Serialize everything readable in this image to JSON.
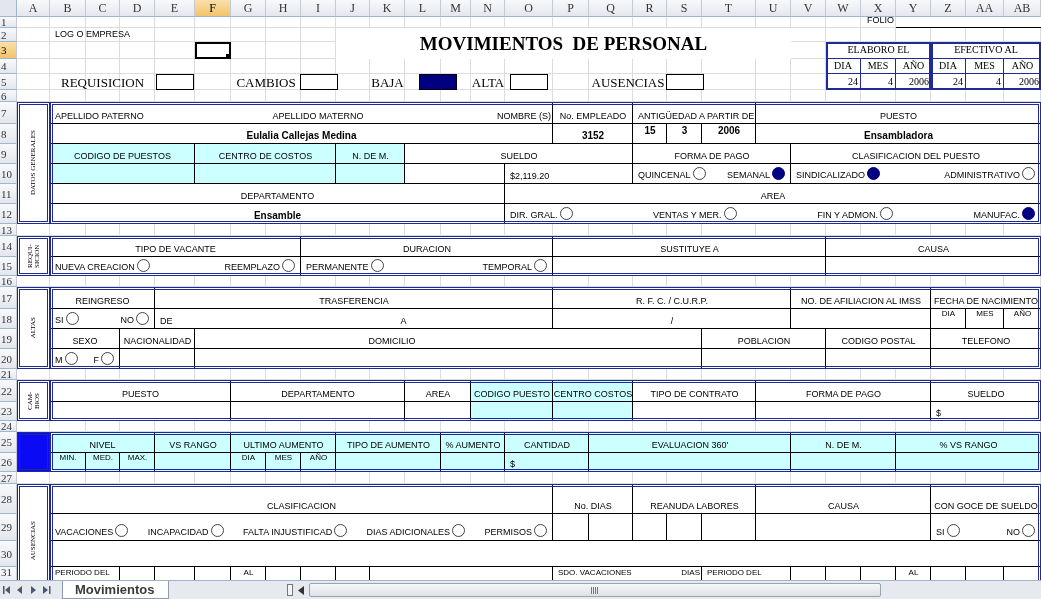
{
  "column_headers": [
    {
      "label": "A",
      "selected": false
    },
    {
      "label": "B",
      "selected": false
    },
    {
      "label": "C",
      "selected": false
    },
    {
      "label": "D",
      "selected": false
    },
    {
      "label": "E",
      "selected": false
    },
    {
      "label": "F",
      "selected": true
    },
    {
      "label": "G",
      "selected": false
    },
    {
      "label": "H",
      "selected": false
    },
    {
      "label": "I",
      "selected": false
    },
    {
      "label": "J",
      "selected": false
    },
    {
      "label": "K",
      "selected": false
    },
    {
      "label": "L",
      "selected": false
    },
    {
      "label": "M",
      "selected": false
    },
    {
      "label": "N",
      "selected": false
    },
    {
      "label": "O",
      "selected": false
    },
    {
      "label": "P",
      "selected": false
    },
    {
      "label": "Q",
      "selected": false
    },
    {
      "label": "R",
      "selected": false
    },
    {
      "label": "S",
      "selected": false
    },
    {
      "label": "T",
      "selected": false
    },
    {
      "label": "U",
      "selected": false
    },
    {
      "label": "V",
      "selected": false
    },
    {
      "label": "W",
      "selected": false
    },
    {
      "label": "X",
      "selected": false
    },
    {
      "label": "Y",
      "selected": false
    },
    {
      "label": "Z",
      "selected": false
    },
    {
      "label": "AA",
      "selected": false
    },
    {
      "label": "AB",
      "selected": false
    }
  ],
  "row_headers": [
    {
      "label": "1",
      "selected": false
    },
    {
      "label": "2",
      "selected": false
    },
    {
      "label": "3",
      "selected": true
    },
    {
      "label": "4",
      "selected": false
    },
    {
      "label": "5",
      "selected": false
    },
    {
      "label": "6",
      "selected": false
    },
    {
      "label": "7",
      "selected": false
    },
    {
      "label": "8",
      "selected": false
    },
    {
      "label": "9",
      "selected": false
    },
    {
      "label": "10",
      "selected": false
    },
    {
      "label": "11",
      "selected": false
    },
    {
      "label": "12",
      "selected": false
    },
    {
      "label": "13",
      "selected": false
    },
    {
      "label": "14",
      "selected": false
    },
    {
      "label": "15",
      "selected": false
    },
    {
      "label": "16",
      "selected": false
    },
    {
      "label": "17",
      "selected": false
    },
    {
      "label": "18",
      "selected": false
    },
    {
      "label": "19",
      "selected": false
    },
    {
      "label": "20",
      "selected": false
    },
    {
      "label": "21",
      "selected": false
    },
    {
      "label": "22",
      "selected": false
    },
    {
      "label": "23",
      "selected": false
    },
    {
      "label": "24",
      "selected": false
    },
    {
      "label": "25",
      "selected": false
    },
    {
      "label": "26",
      "selected": false
    },
    {
      "label": "27",
      "selected": false
    },
    {
      "label": "28",
      "selected": false
    },
    {
      "label": "29",
      "selected": false
    },
    {
      "label": "30",
      "selected": false
    },
    {
      "label": "31",
      "selected": false
    }
  ],
  "logo_text": "LOG O EMPRESA",
  "title": "MOVIMIENTOS  DE PERSONAL",
  "folio_label": "FOLIO",
  "movement_types": [
    {
      "label": "REQUISICION",
      "checked": false
    },
    {
      "label": "CAMBIOS",
      "checked": false
    },
    {
      "label": "BAJA",
      "checked": true
    },
    {
      "label": "ALTA",
      "checked": false
    },
    {
      "label": "AUSENCIAS",
      "checked": false
    }
  ],
  "date_blocks": [
    {
      "title": "ELABORO EL",
      "columns": [
        "DIA",
        "MES",
        "AÑO"
      ],
      "values": [
        "24",
        "4",
        "2006"
      ]
    },
    {
      "title": "EFECTIVO AL",
      "columns": [
        "DIA",
        "MES",
        "AÑO"
      ],
      "values": [
        "24",
        "4",
        "2006"
      ]
    }
  ],
  "sections": [
    {
      "kind": "labeled",
      "label": "DATOS GENERALES",
      "cells": [
        {
          "kind": "label",
          "text": "APELLIDO PATERNO"
        },
        {
          "kind": "label",
          "text": "APELLIDO MATERNO"
        },
        {
          "kind": "label",
          "text": "NOMBRE (S)"
        },
        {
          "kind": "label",
          "text": "No. EMPLEADO"
        },
        {
          "kind": "label",
          "text": "ANTIGÜEDAD A PARTIR DE"
        },
        {
          "kind": "label",
          "text": "PUESTO"
        },
        {
          "kind": "value",
          "text": "Eulalia Callejas Medina"
        },
        {
          "kind": "value",
          "text": "3152"
        },
        {
          "kind": "value",
          "text": "15"
        },
        {
          "kind": "value",
          "text": "3"
        },
        {
          "kind": "value",
          "text": "2006"
        },
        {
          "kind": "value",
          "text": "Ensambladora"
        },
        {
          "kind": "label",
          "text": "CODIGO DE PUESTOS"
        },
        {
          "kind": "label",
          "text": "CENTRO DE COSTOS"
        },
        {
          "kind": "label",
          "text": "N. DE M."
        },
        {
          "kind": "label",
          "text": "SUELDO"
        },
        {
          "kind": "label",
          "text": "FORMA DE PAGO"
        },
        {
          "kind": "label",
          "text": "CLASIFICACION DEL PUESTO"
        },
        {
          "kind": "label",
          "text": "$2,119.20"
        },
        {
          "kind": "options",
          "options": [
            {
              "label": "QUINCENAL",
              "checked": false
            },
            {
              "label": "SEMANAL",
              "checked": true
            }
          ]
        },
        {
          "kind": "options",
          "options": [
            {
              "label": "SINDICALIZADO",
              "checked": true
            },
            {
              "label": "ADMINISTRATIVO",
              "checked": false
            }
          ]
        },
        {
          "kind": "label",
          "text": "DEPARTAMENTO"
        },
        {
          "kind": "label",
          "text": "AREA"
        },
        {
          "kind": "value",
          "text": "Ensamble"
        },
        {
          "kind": "options",
          "options": [
            {
              "label": "DIR. GRAL.",
              "checked": false
            },
            {
              "label": "VENTAS Y MER.",
              "checked": false
            },
            {
              "label": "FIN Y ADMON.",
              "checked": false
            },
            {
              "label": "MANUFAC.",
              "checked": true
            }
          ]
        }
      ]
    },
    {
      "kind": "labeled",
      "label": "REQUI-SICION",
      "cells": [
        {
          "kind": "label",
          "text": "TIPO DE VACANTE"
        },
        {
          "kind": "label",
          "text": "DURACION"
        },
        {
          "kind": "label",
          "text": "SUSTITUYE A"
        },
        {
          "kind": "label",
          "text": "CAUSA"
        },
        {
          "kind": "options",
          "options": [
            {
              "label": "NUEVA CREACION",
              "checked": false
            },
            {
              "label": "REEMPLAZO",
              "checked": false
            }
          ]
        },
        {
          "kind": "options",
          "options": [
            {
              "label": "PERMANENTE",
              "checked": false
            },
            {
              "label": "TEMPORAL",
              "checked": false
            }
          ]
        }
      ]
    },
    {
      "kind": "labeled",
      "label": "ALTAS",
      "cells": [
        {
          "kind": "label",
          "text": "REINGRESO"
        },
        {
          "kind": "label",
          "text": "TRASFERENCIA"
        },
        {
          "kind": "label",
          "text": "R. F. C. / C.U.R.P."
        },
        {
          "kind": "label",
          "text": "NO. DE AFILIACION AL IMSS"
        },
        {
          "kind": "label",
          "text": "FECHA DE NACIMIENTO"
        },
        {
          "kind": "options",
          "options": [
            {
              "label": "SI",
              "checked": false
            },
            {
              "label": "NO",
              "checked": false
            }
          ]
        },
        {
          "kind": "label",
          "text": "DE"
        },
        {
          "kind": "label",
          "text": "A"
        },
        {
          "kind": "label",
          "text": "/"
        },
        {
          "kind": "sublabel",
          "text": "DIA"
        },
        {
          "kind": "sublabel",
          "text": "MES"
        },
        {
          "kind": "sublabel",
          "text": "AÑO"
        },
        {
          "kind": "label",
          "text": "SEXO"
        },
        {
          "kind": "label",
          "text": "NACIONALIDAD"
        },
        {
          "kind": "label",
          "text": "DOMICILIO"
        },
        {
          "kind": "label",
          "text": "POBLACION"
        },
        {
          "kind": "label",
          "text": "CODIGO POSTAL"
        },
        {
          "kind": "label",
          "text": "TELEFONO"
        },
        {
          "kind": "options",
          "options": [
            {
              "label": "M",
              "checked": false
            },
            {
              "label": "F",
              "checked": false
            }
          ]
        }
      ]
    },
    {
      "kind": "labeled",
      "label": "CAM-BIOS",
      "cells": [
        {
          "kind": "label",
          "text": "PUESTO"
        },
        {
          "kind": "label",
          "text": "DEPARTAMENTO"
        },
        {
          "kind": "label",
          "text": "AREA"
        },
        {
          "kind": "label",
          "text": "CODIGO PUESTO"
        },
        {
          "kind": "label",
          "text": "CENTRO COSTOS"
        },
        {
          "kind": "label",
          "text": "TIPO DE CONTRATO"
        },
        {
          "kind": "label",
          "text": "FORMA DE PAGO"
        },
        {
          "kind": "label",
          "text": "SUELDO"
        },
        {
          "kind": "label",
          "text": "$"
        }
      ]
    },
    {
      "kind": "highlighted",
      "cells": [
        {
          "kind": "label",
          "text": "NIVEL"
        },
        {
          "kind": "label",
          "text": "VS RANGO"
        },
        {
          "kind": "label",
          "text": "ULTIMO AUMENTO"
        },
        {
          "kind": "label",
          "text": "TIPO DE AUMENTO"
        },
        {
          "kind": "label",
          "text": "% AUMENTO"
        },
        {
          "kind": "label",
          "text": "CANTIDAD"
        },
        {
          "kind": "label",
          "text": "EVALUACION 360'"
        },
        {
          "kind": "label",
          "text": "N. DE M."
        },
        {
          "kind": "label",
          "text": "% VS RANGO"
        },
        {
          "kind": "sublabel",
          "text": "MIN."
        },
        {
          "kind": "sublabel",
          "text": "MED."
        },
        {
          "kind": "sublabel",
          "text": "MAX."
        },
        {
          "kind": "sublabel",
          "text": "DIA"
        },
        {
          "kind": "sublabel",
          "text": "MES"
        },
        {
          "kind": "sublabel",
          "text": "AÑO"
        },
        {
          "kind": "label",
          "text": "$"
        }
      ]
    },
    {
      "kind": "labeled",
      "label": "AUSENCIAS",
      "cells": [
        {
          "kind": "label",
          "text": "CLASIFICACION"
        },
        {
          "kind": "label",
          "text": "No. DIAS"
        },
        {
          "kind": "label",
          "text": "REANUDA LABORES"
        },
        {
          "kind": "label",
          "text": "CAUSA"
        },
        {
          "kind": "label",
          "text": "CON GOCE DE SUELDO"
        },
        {
          "kind": "options",
          "options": [
            {
              "label": "VACACIONES",
              "checked": false
            },
            {
              "label": "INCAPACIDAD",
              "checked": false
            },
            {
              "label": "FALTA INJUSTIFICAD",
              "checked": false
            },
            {
              "label": "DIAS ADICIONALES",
              "checked": false
            },
            {
              "label": "PERMISOS",
              "checked": false
            }
          ]
        },
        {
          "kind": "options",
          "options": [
            {
              "label": "SI",
              "checked": false
            },
            {
              "label": "NO",
              "checked": false
            }
          ]
        },
        {
          "kind": "label",
          "text": "PERIODO DEL"
        },
        {
          "kind": "label",
          "text": "AL"
        },
        {
          "kind": "label",
          "text": "SDO. VACACIONES"
        },
        {
          "kind": "label",
          "text": "DIAS"
        },
        {
          "kind": "label",
          "text": "PERIODO DEL"
        },
        {
          "kind": "label",
          "text": "AL"
        }
      ]
    }
  ],
  "sheet_tabs": [
    {
      "label": "Movimientos",
      "selected": true
    }
  ]
}
